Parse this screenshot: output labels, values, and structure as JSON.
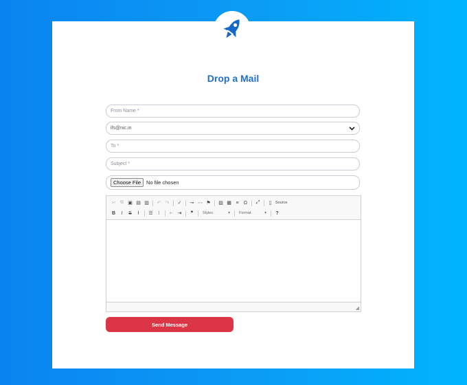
{
  "form": {
    "title": "Drop a Mail",
    "from_placeholder": "From Name *",
    "from_select_value": "ifs@nic.in",
    "to_placeholder": "To *",
    "subject_placeholder": "Subject *",
    "file_button_label": "Choose File",
    "file_status": "No file chosen",
    "send_label": "Send Message"
  },
  "editor": {
    "source_label": "Source",
    "styles_label": "Styles",
    "format_label": "Format",
    "bold_label": "B",
    "italic_label": "I",
    "strike_label": "S",
    "help_label": "?"
  },
  "colors": {
    "accent": "#1d6fd1",
    "send_button": "#dc3545",
    "background_start": "#0a84f0",
    "background_end": "#00b4ff"
  },
  "icons": {
    "logo": "rocket-icon",
    "select_arrow": "chevron-down-icon"
  }
}
